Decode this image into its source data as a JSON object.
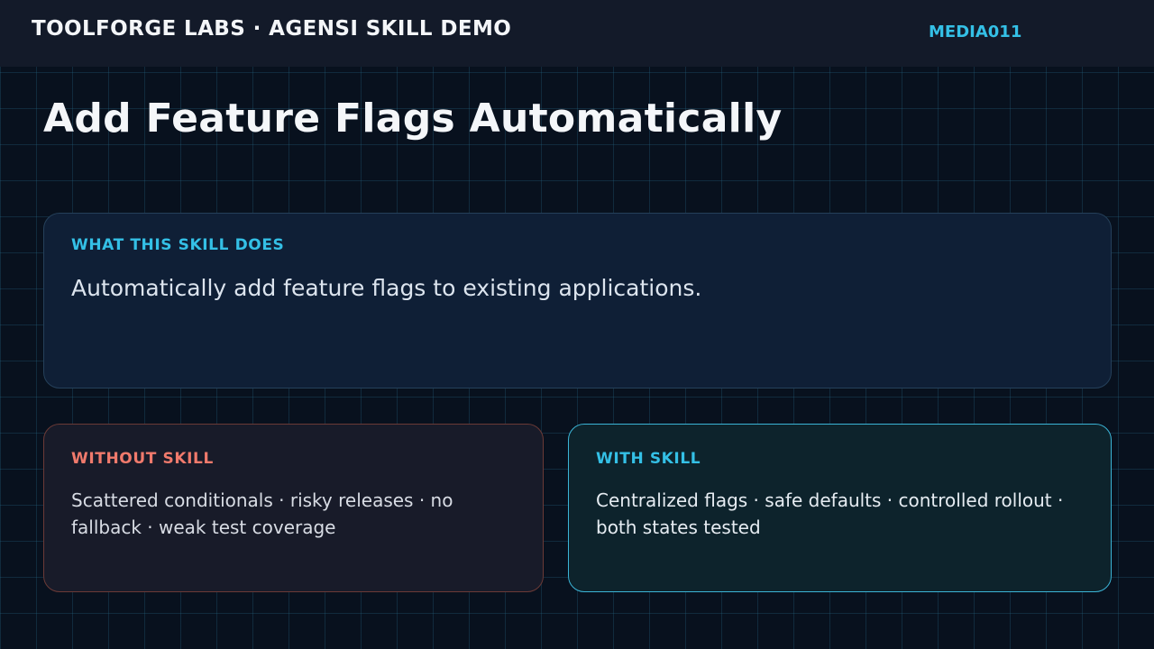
{
  "header": {
    "brand": "TOOLFORGE LABS · AGENSI SKILL DEMO",
    "code": "MEDIA011"
  },
  "page": {
    "title": "Add Feature Flags Automatically"
  },
  "what_card": {
    "label": "WHAT THIS SKILL DOES",
    "text": "Automatically add feature flags to existing applications."
  },
  "without_card": {
    "label": "WITHOUT SKILL",
    "text": "Scattered conditionals · risky releases · no fallback · weak test coverage"
  },
  "with_card": {
    "label": "WITH SKILL",
    "text": "Centralized flags · safe defaults · controlled rollout · both states tested"
  },
  "colors": {
    "background": "#08111e",
    "header_background": "#131a29",
    "accent_cyan": "#34c0e6",
    "negative_red": "#f07a6c",
    "what_card_background": "#0f1f36",
    "without_card_background": "#181b29",
    "with_card_background": "#0d232c"
  }
}
